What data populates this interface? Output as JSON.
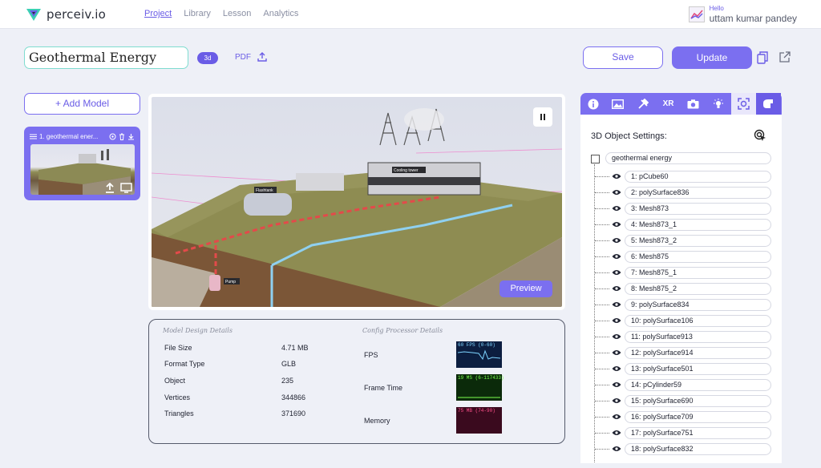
{
  "app": {
    "name": "perceiv.io"
  },
  "nav": [
    "Project",
    "Library",
    "Lesson",
    "Analytics"
  ],
  "user": {
    "greeting": "Hello",
    "name": "uttam kumar pandey"
  },
  "project": {
    "title": "Geothermal Energy",
    "badge": "3d",
    "pdf_label": "PDF"
  },
  "actions": {
    "save": "Save",
    "update": "Update"
  },
  "left": {
    "add_model": "+ Add Model",
    "model_name": "1. geothermal ener..."
  },
  "viewport": {
    "preview_label": "Preview"
  },
  "details": {
    "model_title": "Model Design Details",
    "config_title": "Config Processor Details",
    "rows": [
      {
        "label": "File Size",
        "value": "4.71 MB"
      },
      {
        "label": "Format Type",
        "value": "GLB"
      },
      {
        "label": "Object",
        "value": "235"
      },
      {
        "label": "Vertices",
        "value": "344866"
      },
      {
        "label": "Triangles",
        "value": "371690"
      }
    ],
    "perf": [
      {
        "label": "FPS",
        "caption": "60 FPS (0-60)",
        "fg": "#7ed4ff",
        "bg": "#0c1e40"
      },
      {
        "label": "Frame Time",
        "caption": "19 MS (6-117433)",
        "fg": "#7bff4f",
        "bg": "#0b2a0a"
      },
      {
        "label": "Memory",
        "caption": "75 MB (74-90)",
        "fg": "#ff4f8a",
        "bg": "#3a0a1e"
      }
    ]
  },
  "settings": {
    "title": "3D Object Settings:",
    "root": "geothermal energy",
    "items": [
      "1: pCube60",
      "2: polySurface836",
      "3: Mesh873",
      "4: Mesh873_1",
      "5: Mesh873_2",
      "6: Mesh875",
      "7: Mesh875_1",
      "8: Mesh875_2",
      "9: polySurface834",
      "10: polySurface106",
      "11: polySurface913",
      "12: polySurface914",
      "13: polySurface501",
      "14: pCylinder59",
      "15: polySurface690",
      "16: polySurface709",
      "17: polySurface751",
      "18: polySurface832"
    ]
  },
  "tabs": [
    {
      "icon": "info-icon"
    },
    {
      "icon": "image-icon"
    },
    {
      "icon": "tools-icon"
    },
    {
      "icon": "xr-icon",
      "label": "XR"
    },
    {
      "icon": "camera-icon"
    },
    {
      "icon": "light-icon"
    },
    {
      "icon": "object-focus-icon"
    },
    {
      "icon": "hand-icon"
    }
  ],
  "scene_labels": [
    "Cooling tower",
    "Flashtank",
    "Pump"
  ]
}
